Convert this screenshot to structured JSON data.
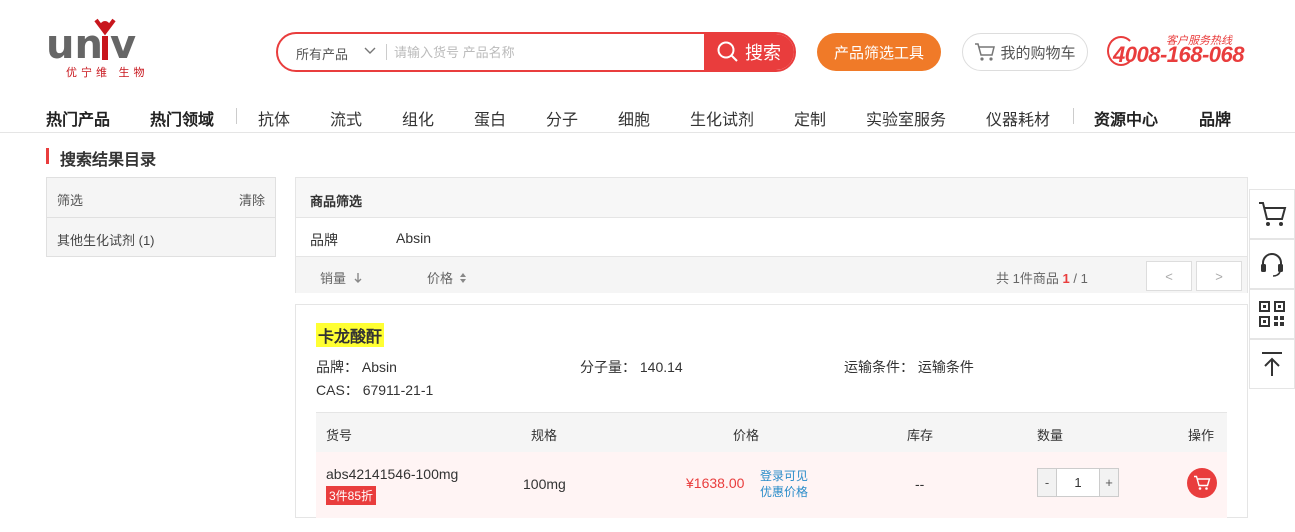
{
  "logo": {
    "text": "univ",
    "subtitle": "优宁维 生物"
  },
  "search": {
    "category": "所有产品",
    "placeholder": "请输入货号 产品名称",
    "button_label": "搜索"
  },
  "header_buttons": {
    "filter_tool": "产品筛选工具",
    "cart": "我的购物车"
  },
  "hotline": {
    "label": "客户服务热线",
    "number": "4008-168-068"
  },
  "nav": {
    "items": [
      "热门产品",
      "热门领域",
      "抗体",
      "流式",
      "组化",
      "蛋白",
      "分子",
      "细胞",
      "生化试剂",
      "定制",
      "实验室服务",
      "仪器耗材",
      "资源中心",
      "品牌"
    ]
  },
  "breadcrumb": {
    "title": "搜索结果目录"
  },
  "left_filter": {
    "title": "筛选",
    "clear": "清除",
    "item": "其他生化试剂 (1)"
  },
  "product_filter": {
    "title": "商品筛选",
    "brand_label": "品牌",
    "brand_value": "Absin"
  },
  "sort": {
    "sales": "销量",
    "price": "价格",
    "total_prefix": "共",
    "total_count": "1",
    "total_suffix": "件商品",
    "page_current": "1",
    "page_sep": "/",
    "page_total": "1",
    "prev": "<",
    "next": ">"
  },
  "product": {
    "name": "卡龙酸酐",
    "brand_label": "品牌：",
    "brand": "Absin",
    "mw_label": "分子量：",
    "mw": "140.14",
    "shipping_label": "运输条件：",
    "shipping": "运输条件",
    "cas_label": "CAS：",
    "cas": "67911-21-1"
  },
  "table": {
    "headers": [
      "货号",
      "规格",
      "价格",
      "库存",
      "数量",
      "操作"
    ],
    "row": {
      "sku": "abs42141546-100mg",
      "discount": "3件85折",
      "spec": "100mg",
      "price": "¥1638.00",
      "login_line1": "登录可见",
      "login_line2": "优惠价格",
      "stock": "--",
      "qty_minus": "-",
      "qty": "1",
      "qty_plus": "+"
    }
  },
  "colors": {
    "accent": "#e93d3d",
    "orange": "#f07a28",
    "link": "#2a8cc9",
    "highlight": "#ffff33"
  }
}
